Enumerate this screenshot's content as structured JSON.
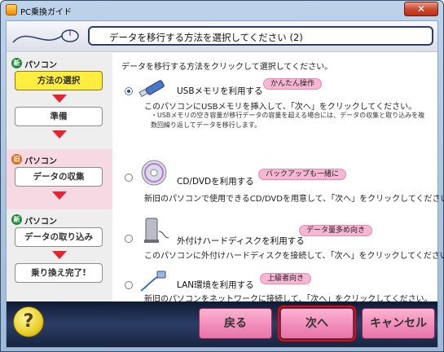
{
  "window": {
    "title": "PC乗換ガイド",
    "close_label": "✕"
  },
  "header": {
    "title": "データを移行する方法を選択してください (2)"
  },
  "sidebar": {
    "sections": [
      {
        "badge": "新",
        "label": "パソコン",
        "steps": [
          "方法の選択",
          "準備"
        ]
      },
      {
        "badge": "旧",
        "label": "パソコン",
        "steps": [
          "データの収集"
        ]
      },
      {
        "badge": "新",
        "label": "パソコン",
        "steps": [
          "データの取り込み",
          "乗り換え完了!"
        ]
      }
    ]
  },
  "main": {
    "instruction": "データを移行する方法をクリックして選択してください。",
    "options": [
      {
        "title": "USBメモリを利用する",
        "tag": "かんたん操作",
        "icon": "usb-memory-icon",
        "desc": "このパソコンにUSBメモリを挿入して、「次へ」をクリックしてください。",
        "note": "・USBメモリの空き容量が移行データの容量を超える場合には、データの収集と取り込みを複数回繰り返してデータを移行します。",
        "checked": true
      },
      {
        "title": "CD/DVDを利用する",
        "tag": "バックアップも一緒に",
        "icon": "cd-dvd-icon",
        "desc": "新旧のパソコンで使用できるCD/DVDを用意して、「次へ」をクリックしてください。",
        "checked": false
      },
      {
        "title": "外付けハードディスクを利用する",
        "tag": "データ量多め向き",
        "icon": "external-hdd-icon",
        "desc": "このパソコンに外付けハードディスクを接続して、「次へ」をクリックしてください。",
        "checked": false
      },
      {
        "title": "LAN環境を利用する",
        "tag": "上級者向き",
        "icon": "lan-cable-icon",
        "desc": "新旧のパソコンをネットワークに接続して、「次へ」をクリックしてください。",
        "checked": false
      }
    ]
  },
  "footer": {
    "help_label": "?",
    "back_label": "戻る",
    "next_label": "次へ",
    "cancel_label": "キャンセル"
  },
  "colors": {
    "active_step": "#ffed40",
    "arrow": "#e8222e",
    "tag": "#f7b6d2",
    "button": "#f28dbb",
    "highlight": "#ff0000"
  }
}
